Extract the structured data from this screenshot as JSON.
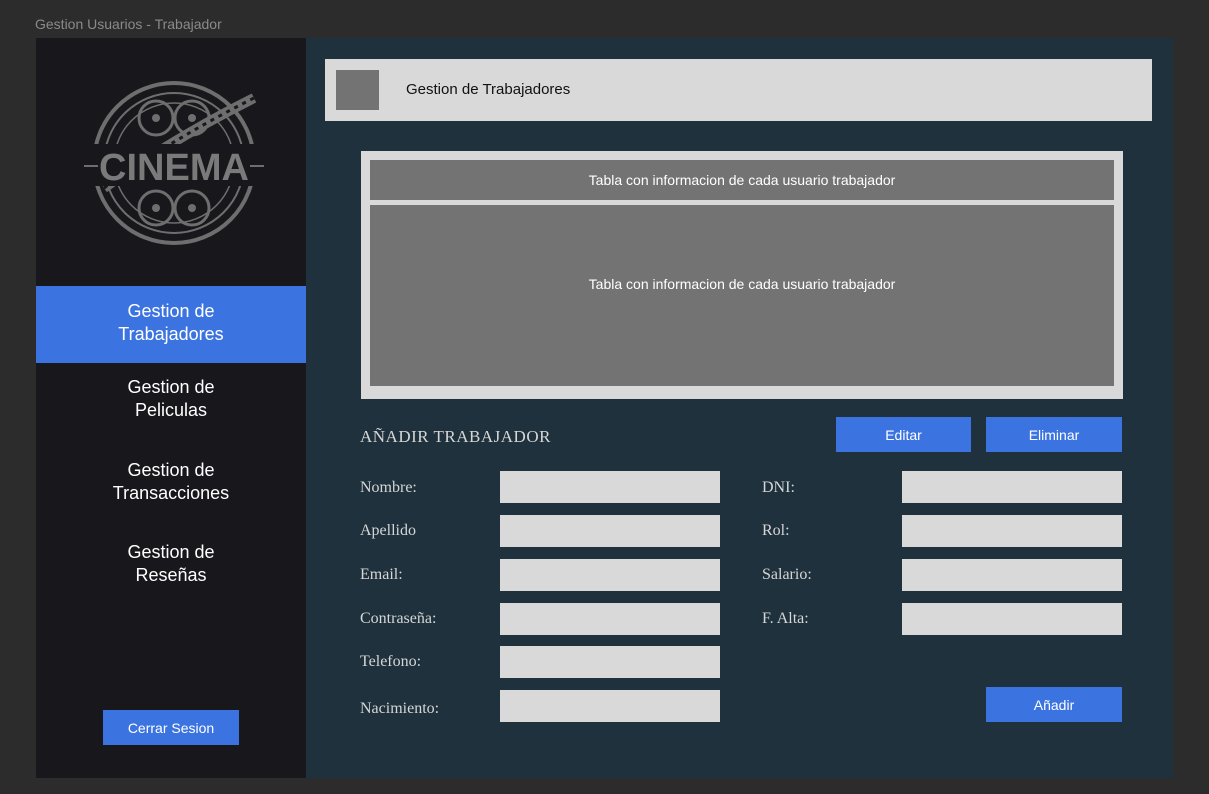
{
  "window": {
    "title": "Gestion Usuarios - Trabajador"
  },
  "colors": {
    "accent": "#3b74e0",
    "sidebar_bg": "#17171c",
    "main_bg": "#1e313c",
    "panel": "#d9d9d9",
    "placeholder": "#737373"
  },
  "logo": {
    "text": "CINEMA",
    "icon": "film-reel-logo"
  },
  "sidebar": {
    "items": [
      {
        "line1": "Gestion de",
        "line2": "Trabajadores",
        "active": true
      },
      {
        "line1": "Gestion de",
        "line2": "Peliculas",
        "active": false
      },
      {
        "line1": "Gestion de",
        "line2": "Transacciones",
        "active": false
      },
      {
        "line1": "Gestion de",
        "line2": "Reseñas",
        "active": false
      }
    ],
    "logout_label": "Cerrar Sesion"
  },
  "header": {
    "title": "Gestion de Trabajadores"
  },
  "table": {
    "header_text": "Tabla con informacion de cada usuario trabajador",
    "body_text": "Tabla con informacion de cada usuario trabajador"
  },
  "form": {
    "title": "AÑADIR TRABAJADOR",
    "edit_label": "Editar",
    "delete_label": "Eliminar",
    "add_label": "Añadir",
    "left_fields": [
      {
        "label": "Nombre:",
        "value": ""
      },
      {
        "label": "Apellido",
        "value": ""
      },
      {
        "label": "Email:",
        "value": ""
      },
      {
        "label": "Contraseña:",
        "value": ""
      },
      {
        "label": "Telefono:",
        "value": ""
      },
      {
        "label": "Nacimiento:",
        "value": ""
      }
    ],
    "right_fields": [
      {
        "label": "DNI:",
        "value": ""
      },
      {
        "label": "Rol:",
        "value": ""
      },
      {
        "label": "Salario:",
        "value": ""
      },
      {
        "label": "F. Alta:",
        "value": ""
      }
    ]
  }
}
